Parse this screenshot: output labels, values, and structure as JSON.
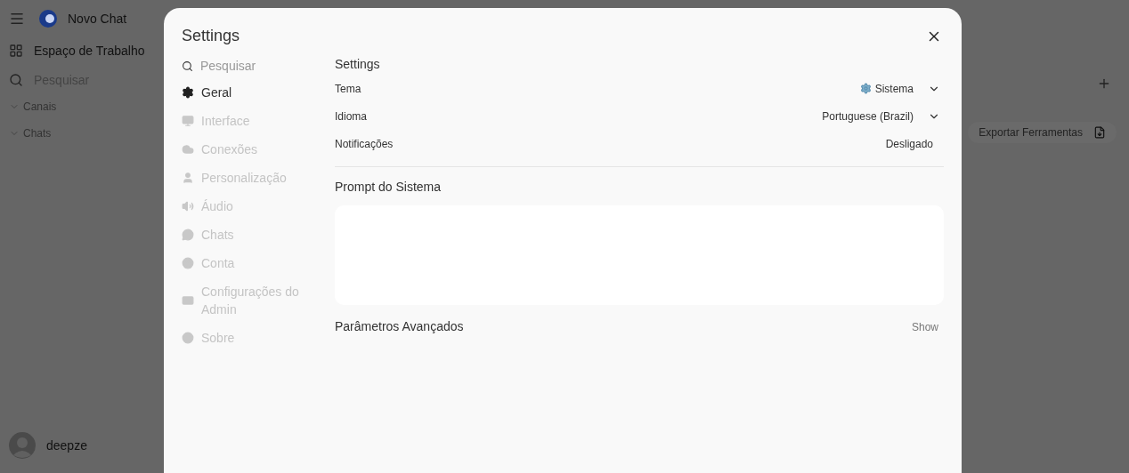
{
  "sidebar": {
    "new_chat": "Novo Chat",
    "workspace": "Espaço de Trabalho",
    "search": {
      "placeholder": "Pesquisar"
    },
    "sections": [
      {
        "label": "Canais",
        "expanded": true
      },
      {
        "label": "Chats",
        "expanded": true
      }
    ],
    "user": "deepze"
  },
  "main": {
    "export_button": "Exportar Ferramentas"
  },
  "dialog": {
    "title": "Settings",
    "search": {
      "placeholder": "Pesquisar"
    },
    "nav": [
      {
        "label": "Geral",
        "selected": true
      },
      {
        "label": "Interface",
        "selected": false
      },
      {
        "label": "Conexões",
        "selected": false
      },
      {
        "label": "Personalização",
        "selected": false
      },
      {
        "label": "Áudio",
        "selected": false
      },
      {
        "label": "Chats",
        "selected": false
      },
      {
        "label": "Conta",
        "selected": false
      },
      {
        "label": "Configurações do Admin",
        "selected": false
      },
      {
        "label": "Sobre",
        "selected": false
      }
    ],
    "section_title": "Settings",
    "rows": [
      {
        "label": "Tema",
        "value": "Sistema",
        "kind": "theme-dropdown"
      },
      {
        "label": "Idioma",
        "value": "Portuguese (Brazil)",
        "kind": "dropdown"
      },
      {
        "label": "Notificações",
        "value": "Desligado",
        "kind": "toggle"
      }
    ],
    "system_prompt": {
      "label": "Prompt do Sistema"
    },
    "advanced": {
      "label": "Parâmetros Avançados",
      "toggle": "Show"
    }
  }
}
